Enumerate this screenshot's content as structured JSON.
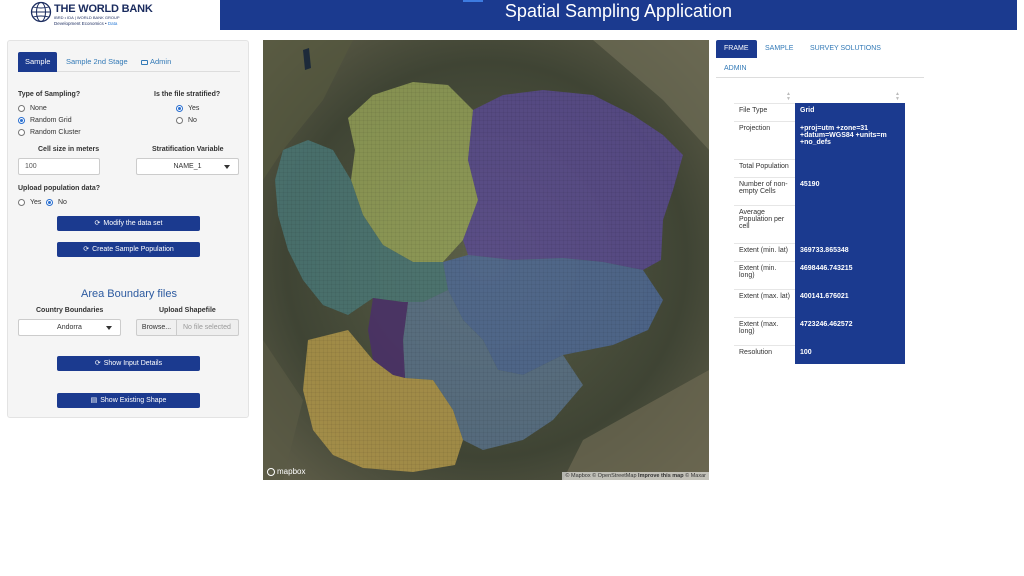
{
  "header": {
    "logo_title": "THE WORLD BANK",
    "logo_sub": "IBRD • IDA | WORLD BANK GROUP",
    "logo_dept": "Development Economics",
    "logo_dept_accent": "Data",
    "app_title": "Spatial Sampling Application"
  },
  "sidebar": {
    "tabs": [
      {
        "label": "Sample",
        "active": true
      },
      {
        "label": "Sample 2nd Stage",
        "active": false
      },
      {
        "label": "Admin",
        "active": false,
        "icon": "admin-icon"
      }
    ],
    "type_label": "Type of Sampling?",
    "type_options": [
      "None",
      "Random Grid",
      "Random Cluster"
    ],
    "type_selected": "Random Grid",
    "strat_label": "Is the file stratified?",
    "strat_options": [
      "Yes",
      "No"
    ],
    "strat_selected": "Yes",
    "cell_size_label": "Cell size in meters",
    "cell_size_value": "100",
    "strat_var_label": "Stratification Variable",
    "strat_var_value": "NAME_1",
    "upload_pop_label": "Upload population data?",
    "upload_pop_options": [
      "Yes",
      "No"
    ],
    "upload_pop_selected": "No",
    "modify_button": "Modify the data set",
    "create_button": "Create Sample Population",
    "area_title": "Area Boundary files",
    "country_label": "Country Boundaries",
    "country_value": "Andorra",
    "shapefile_label": "Upload Shapefile",
    "browse_label": "Browse...",
    "no_file_label": "No file selected",
    "show_input_button": "Show Input Details",
    "show_shape_button": "Show Existing Shape"
  },
  "map": {
    "logo": "mapbox",
    "attribution_1": "© Mapbox © OpenStreetMap",
    "attribution_improve": "Improve this map",
    "attribution_2": "© Maxar"
  },
  "right": {
    "tabs": [
      {
        "label": "FRAME",
        "active": true
      },
      {
        "label": "SAMPLE",
        "active": false
      },
      {
        "label": "SURVEY SOLUTIONS",
        "active": false
      },
      {
        "label": "ADMIN",
        "active": false
      }
    ],
    "table": [
      {
        "key": "File Type",
        "value": "Grid"
      },
      {
        "key": "Projection",
        "value": "+proj=utm +zone=31 +datum=WGS84 +units=m +no_defs"
      },
      {
        "key": "Total Population",
        "value": ""
      },
      {
        "key": "Number of non-empty Cells",
        "value": "45190"
      },
      {
        "key": "Average Population per cell",
        "value": ""
      },
      {
        "key": "Extent (min. lat)",
        "value": "369733.865348"
      },
      {
        "key": "Extent (min. long)",
        "value": "4698446.743215"
      },
      {
        "key": "Extent (max. lat)",
        "value": "400141.676021"
      },
      {
        "key": "Extent (max. long)",
        "value": "4723246.462572"
      },
      {
        "key": "Resolution",
        "value": "100"
      }
    ]
  },
  "colors": {
    "primary": "#1b3a8f",
    "link": "#337ab7"
  }
}
